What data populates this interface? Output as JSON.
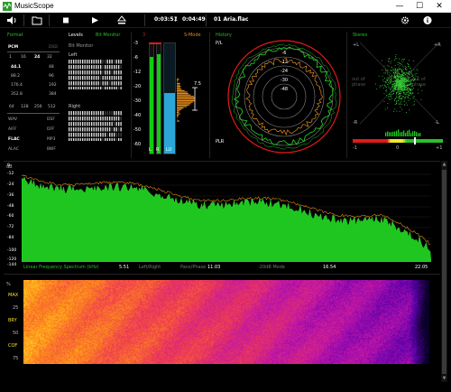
{
  "window": {
    "title": "MusicScope",
    "min_glyph": "—",
    "max_glyph": "☐",
    "close_glyph": "✕"
  },
  "toolbar": {
    "elapsed": "0:03:51",
    "separator": "/",
    "total": "0:04:49",
    "track": "01 Aria.flac"
  },
  "format": {
    "title": "Format",
    "active_format": "PCM",
    "dsd_label": "DSD",
    "bit_depths": [
      "1",
      "16",
      "24",
      "32"
    ],
    "active_bit_depth": "24",
    "sample_rates": [
      [
        "44.1",
        "48"
      ],
      [
        "88.2",
        "96"
      ],
      [
        "176.4",
        "192"
      ],
      [
        "352.8",
        "384"
      ]
    ],
    "active_sample_rate": "44.1",
    "dsd_rates": [
      "64",
      "128",
      "256",
      "512"
    ],
    "containers": [
      [
        "WAV",
        "DSF"
      ],
      [
        "AIFF",
        "DFF"
      ],
      [
        "FLAC",
        "MP3"
      ],
      [
        "ALAC",
        "BWF"
      ]
    ],
    "active_container": "FLAC"
  },
  "levels": {
    "title": "Levels",
    "mode": "Bit Monitor",
    "bit_monitor_label": "Bit Monitor",
    "left_label": "Left",
    "right_label": "Right",
    "scale": [
      "-3",
      "-6",
      "-12",
      "-20",
      "-30",
      "-40",
      "-50",
      "-60"
    ],
    "ch_labels": [
      "L",
      "R",
      "LU"
    ],
    "smode_label": "S-Mode",
    "marker_top": "3",
    "lu_value": "7.5",
    "left_level_fraction": 0.88,
    "right_level_fraction": 0.9,
    "lu_fraction": 0.55
  },
  "history": {
    "title": "History",
    "pl_label": "P/L",
    "plr_label": "PLR",
    "rings": [
      "-6",
      "-12",
      "-24",
      "-30",
      "-48"
    ]
  },
  "stereo": {
    "title": "Stereo",
    "plus_l": "+L",
    "plus_r": "+R",
    "minus_l": "-R",
    "minus_r": "-L",
    "out_phase_left": "out of phase",
    "out_phase_right": "out of phase",
    "corr_minus": "-1",
    "corr_zero": "0",
    "corr_plus": "+1",
    "correlation": 0.35
  },
  "spectrum": {
    "unit": "dB",
    "y_ticks": [
      "0",
      "-12",
      "-24",
      "-36",
      "-48",
      "-60",
      "-72",
      "-84",
      "-100",
      "-120",
      "-144"
    ],
    "caption": "Linear Frequency Spectrum (kHz)",
    "x_ticks": [
      "5.51",
      "11.03",
      "16.54",
      "22.05"
    ],
    "modes": [
      "Left/Right",
      "Pans/Phase",
      "-20dB Mode"
    ]
  },
  "spectrogram": {
    "percent_label": "%",
    "labels": [
      "MAX",
      "25",
      "BRY",
      "50",
      "COF",
      "75"
    ]
  },
  "colors": {
    "green": "#1fc61f",
    "red": "#e01a1a",
    "blue": "#2aa7d6",
    "orange": "#e38a1a",
    "accent": "#37c837"
  }
}
